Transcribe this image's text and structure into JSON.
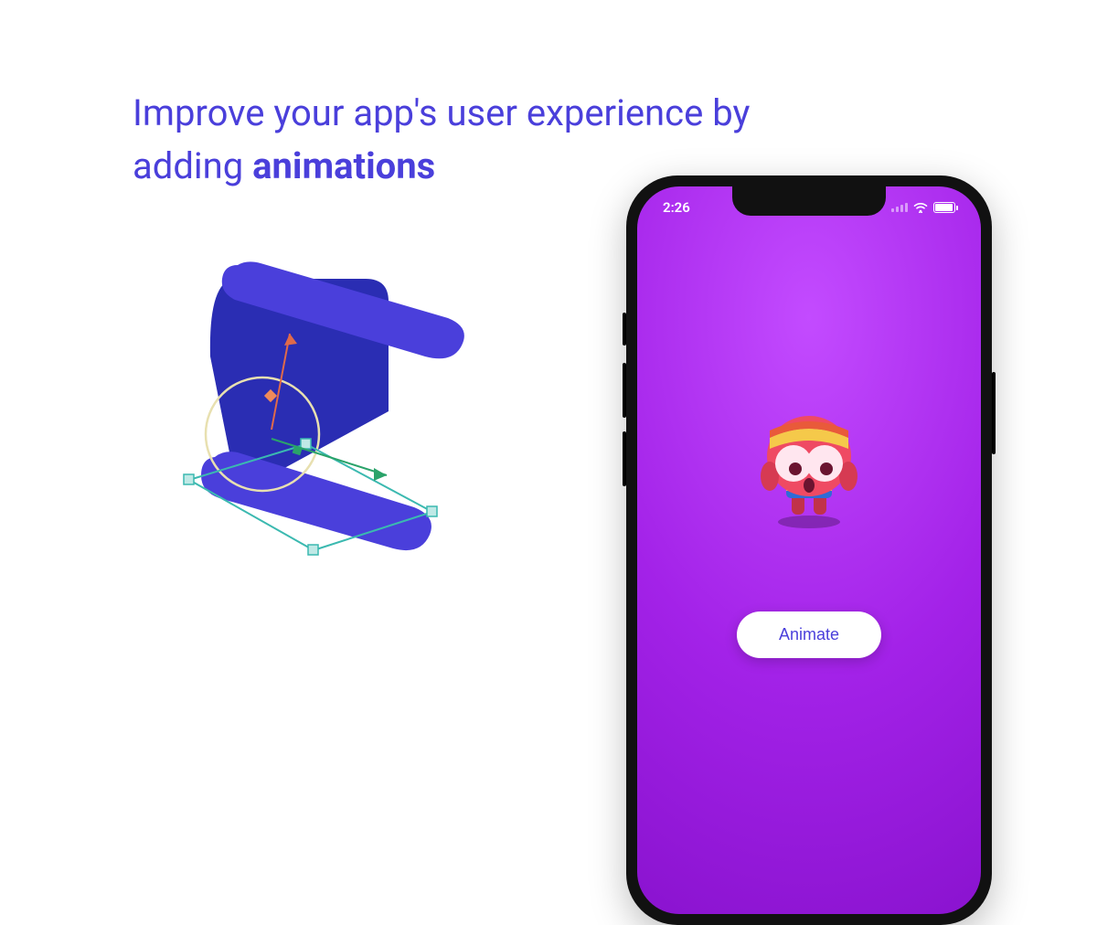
{
  "headline": {
    "line1": "Improve your app's user experience by",
    "line2_prefix": "adding ",
    "line2_bold": "animations"
  },
  "phone": {
    "time": "2:26",
    "button_label": "Animate"
  },
  "colors": {
    "accent": "#4a3fdb",
    "screen_gradient_top": "#c34bff",
    "screen_gradient_bottom": "#8a13cf"
  }
}
